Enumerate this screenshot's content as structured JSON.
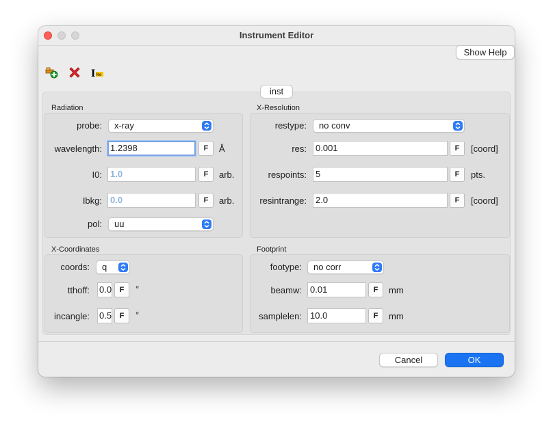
{
  "window": {
    "title": "Instrument Editor"
  },
  "toolbar": {
    "show_help": "Show Help",
    "icons": [
      "add-instrument-icon",
      "delete-instrument-icon",
      "rename-instrument-icon"
    ],
    "rename_icon_text": "I",
    "rename_icon_sub": "Ne"
  },
  "tab": {
    "label": "inst"
  },
  "radiation": {
    "title": "Radiation",
    "probe": {
      "label": "probe:",
      "value": "x-ray"
    },
    "wavelength": {
      "label": "wavelength:",
      "value": "1.2398",
      "fit": "F",
      "unit": "Å"
    },
    "i0": {
      "label": "I0:",
      "value": "1.0",
      "fit": "F",
      "unit": "arb."
    },
    "ibkg": {
      "label": "Ibkg:",
      "value": "0.0",
      "fit": "F",
      "unit": "arb."
    },
    "pol": {
      "label": "pol:",
      "value": "uu"
    }
  },
  "xresolution": {
    "title": "X-Resolution",
    "restype": {
      "label": "restype:",
      "value": "no conv"
    },
    "res": {
      "label": "res:",
      "value": "0.001",
      "fit": "F",
      "unit": "[coord]"
    },
    "respoints": {
      "label": "respoints:",
      "value": "5",
      "fit": "F",
      "unit": "pts."
    },
    "resintrange": {
      "label": "resintrange:",
      "value": "2.0",
      "fit": "F",
      "unit": "[coord]"
    }
  },
  "xcoordinates": {
    "title": "X-Coordinates",
    "coords": {
      "label": "coords:",
      "value": "q"
    },
    "tthoff": {
      "label": "tthoff:",
      "value": "0.0",
      "fit": "F",
      "unit": "°"
    },
    "incangle": {
      "label": "incangle:",
      "value": "0.5",
      "fit": "F",
      "unit": "°"
    }
  },
  "footprint": {
    "title": "Footprint",
    "footype": {
      "label": "footype:",
      "value": "no corr"
    },
    "beamw": {
      "label": "beamw:",
      "value": "0.01",
      "fit": "F",
      "unit": "mm"
    },
    "samplelen": {
      "label": "samplelen:",
      "value": "10.0",
      "fit": "F",
      "unit": "mm"
    }
  },
  "buttons": {
    "cancel": "Cancel",
    "ok": "OK"
  },
  "colors": {
    "accent": "#1a74f2",
    "close": "#ff5f57",
    "dim_value": "#8fb3d9"
  }
}
